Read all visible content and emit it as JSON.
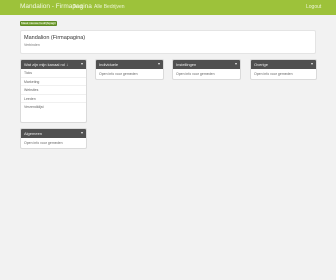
{
  "header": {
    "brand": "Mandalion - Firmapagina",
    "nav": [
      "Test",
      "Alle Bedrijven"
    ],
    "logout": "Logout"
  },
  "action_button": "Maak nieuwe bedrijfspagina aan",
  "hero": {
    "title": "Mandalion (Firmapagina)",
    "subtitle": "Verbinden"
  },
  "sidebar_panel": {
    "title": "Wat zijn mijn kanaal rol ↓",
    "items": [
      "Ticks",
      "Marketing",
      "Websites",
      "Leeden",
      "Verzendklijst"
    ]
  },
  "bottom_panel": {
    "title": "Algemeen",
    "text": "Open info voor gemeden"
  },
  "col2_panel": {
    "title": "Individuele",
    "text": "Open info voor gemeden"
  },
  "col3_panel": {
    "title": "Instellingen",
    "text": "Open info voor gemeden"
  },
  "col4_panel": {
    "title": "Overige",
    "text": "Open info voor gemeden"
  },
  "colors": {
    "topbar": "#9dc23a",
    "panel_header": "#505050",
    "background": "#f2f2f2",
    "button": "#7aa53a"
  }
}
